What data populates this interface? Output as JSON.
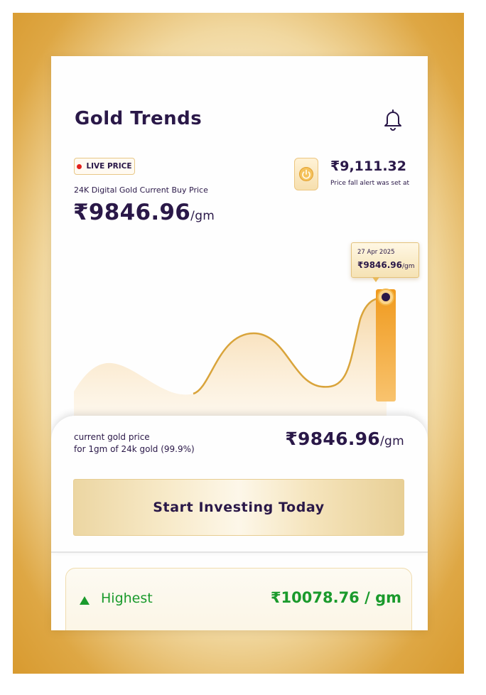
{
  "header": {
    "title": "Gold Trends",
    "bell_icon": "bell-icon"
  },
  "live": {
    "badge": "LIVE PRICE",
    "subtitle": "24K Digital Gold Current Buy Price",
    "price": "₹9846.96",
    "unit": "/gm"
  },
  "alert": {
    "icon": "power-icon",
    "price": "₹9,111.32",
    "note": "Price fall alert was set at"
  },
  "chart": {
    "type": "area",
    "tooltip_date": "27 Apr 2025",
    "tooltip_price": "₹9846.96",
    "tooltip_unit": "/gm",
    "colors": {
      "line": "#d9a43b",
      "fill": "#f6d9a6",
      "marker": "#2a1848",
      "bar": "#f3a52d"
    }
  },
  "summary": {
    "caption_line1": "current gold price",
    "caption_line2": "for 1gm of 24k gold (99.9%)",
    "price": "₹9846.96",
    "unit": "/gm"
  },
  "cta": {
    "label": "Start Investing Today"
  },
  "highest": {
    "label": "Highest",
    "value": "₹10078.76 / gm",
    "color": "#1a9a2c"
  },
  "colors": {
    "text": "#2a1848",
    "frame": "#d89a2f",
    "live_dot": "#e3201b"
  }
}
